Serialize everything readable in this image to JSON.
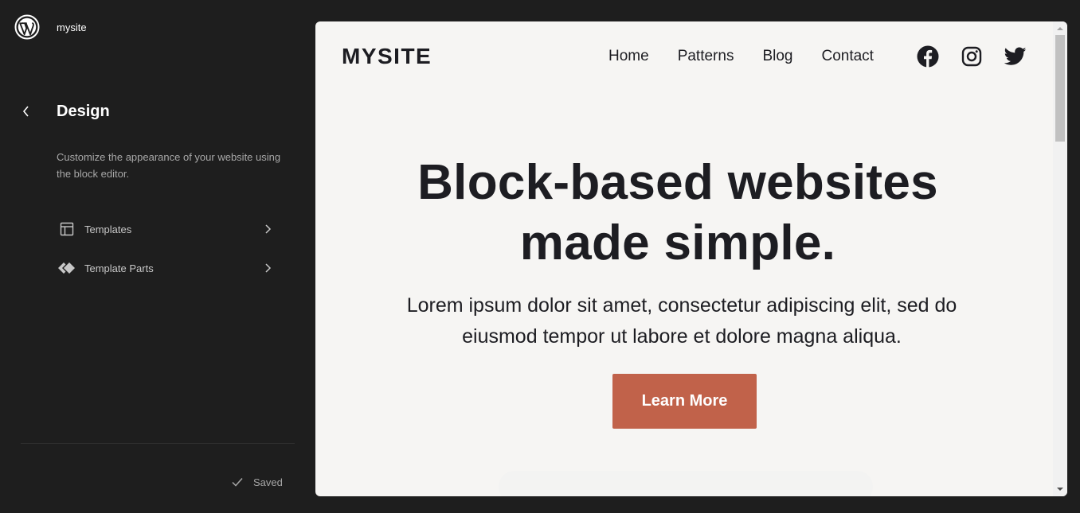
{
  "site_hub": {
    "logo_icon": "wordpress-logo-icon",
    "site_name": "mysite"
  },
  "sidebar": {
    "back_icon": "chevron-left-icon",
    "title": "Design",
    "description": "Customize the appearance of your website using the block editor.",
    "items": [
      {
        "label": "Templates",
        "icon": "layout-icon"
      },
      {
        "label": "Template Parts",
        "icon": "symbol-diamond-icon"
      }
    ],
    "status": {
      "label": "Saved",
      "icon": "check-icon"
    }
  },
  "preview": {
    "brand": "MYSITE",
    "nav": [
      "Home",
      "Patterns",
      "Blog",
      "Contact"
    ],
    "social": [
      "facebook-icon",
      "instagram-icon",
      "twitter-icon"
    ],
    "hero": {
      "heading_line1": "Block-based websites",
      "heading_line2": "made simple.",
      "text_line1": "Lorem ipsum dolor sit amet, consectetur adipiscing elit, sed do",
      "text_line2": "eiusmod tempor ut labore et dolore magna aliqua.",
      "button": "Learn More"
    }
  },
  "colors": {
    "app_background": "#1e1e1e",
    "preview_background": "#f6f5f3",
    "text_dark": "#1d1d22",
    "accent_button": "#c1624a"
  }
}
